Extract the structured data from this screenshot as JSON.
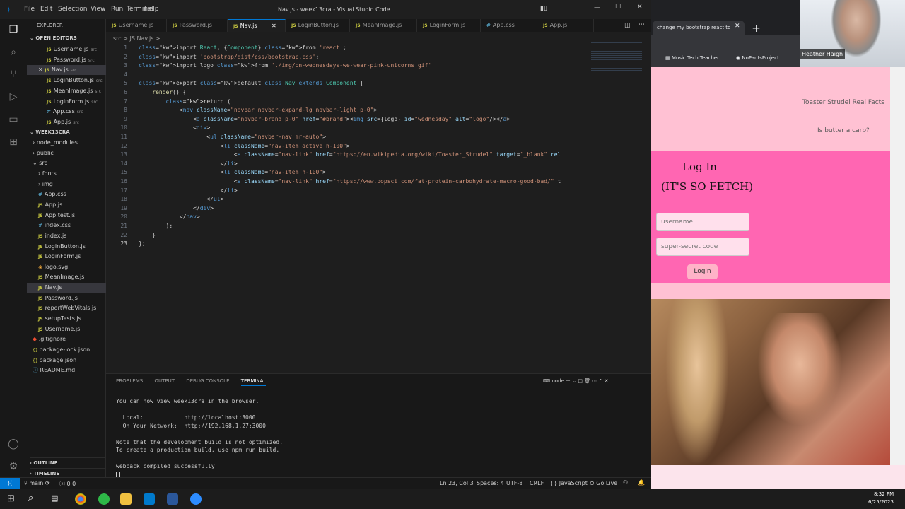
{
  "titlebar": {
    "menus": [
      "File",
      "Edit",
      "Selection",
      "View",
      "Run",
      "Terminal",
      "Help"
    ],
    "title": "Nav.js - week13cra - Visual Studio Code"
  },
  "sidebar": {
    "explorer_label": "EXPLORER",
    "open_editors_label": "OPEN EDITORS",
    "open_editors": [
      {
        "name": "Username.js",
        "hint": "src",
        "type": "js"
      },
      {
        "name": "Password.js",
        "hint": "src",
        "type": "js"
      },
      {
        "name": "Nav.js",
        "hint": "src",
        "type": "js"
      },
      {
        "name": "LoginButton.js",
        "hint": "src",
        "type": "js"
      },
      {
        "name": "MeanImage.js",
        "hint": "src",
        "type": "js"
      },
      {
        "name": "LoginForm.js",
        "hint": "src",
        "type": "js"
      },
      {
        "name": "App.css",
        "hint": "src",
        "type": "css"
      },
      {
        "name": "App.js",
        "hint": "src",
        "type": "js"
      }
    ],
    "project_label": "WEEK13CRA",
    "tree": [
      {
        "name": "node_modules",
        "type": "folder",
        "indent": 1
      },
      {
        "name": "public",
        "type": "folder",
        "indent": 1
      },
      {
        "name": "src",
        "type": "folder-open",
        "indent": 1
      },
      {
        "name": "fonts",
        "type": "folder",
        "indent": 2
      },
      {
        "name": "img",
        "type": "folder",
        "indent": 2
      },
      {
        "name": "App.css",
        "type": "css",
        "indent": 2
      },
      {
        "name": "App.js",
        "type": "js",
        "indent": 2
      },
      {
        "name": "App.test.js",
        "type": "js",
        "indent": 2
      },
      {
        "name": "index.css",
        "type": "css",
        "indent": 2
      },
      {
        "name": "index.js",
        "type": "js",
        "indent": 2
      },
      {
        "name": "LoginButton.js",
        "type": "js",
        "indent": 2
      },
      {
        "name": "LoginForm.js",
        "type": "js",
        "indent": 2
      },
      {
        "name": "logo.svg",
        "type": "svg",
        "indent": 2
      },
      {
        "name": "MeanImage.js",
        "type": "js",
        "indent": 2
      },
      {
        "name": "Nav.js",
        "type": "js",
        "indent": 2
      },
      {
        "name": "Password.js",
        "type": "js",
        "indent": 2
      },
      {
        "name": "reportWebVitals.js",
        "type": "js",
        "indent": 2
      },
      {
        "name": "setupTests.js",
        "type": "js",
        "indent": 2
      },
      {
        "name": "Username.js",
        "type": "js",
        "indent": 2
      },
      {
        "name": ".gitignore",
        "type": "git",
        "indent": 1
      },
      {
        "name": "package-lock.json",
        "type": "json",
        "indent": 1
      },
      {
        "name": "package.json",
        "type": "json",
        "indent": 1
      },
      {
        "name": "README.md",
        "type": "md",
        "indent": 1
      }
    ],
    "outline_label": "OUTLINE",
    "timeline_label": "TIMELINE"
  },
  "tabs": [
    {
      "label": "Username.js",
      "type": "js"
    },
    {
      "label": "Password.js",
      "type": "js"
    },
    {
      "label": "Nav.js",
      "type": "js"
    },
    {
      "label": "LoginButton.js",
      "type": "js"
    },
    {
      "label": "MeanImage.js",
      "type": "js"
    },
    {
      "label": "LoginForm.js",
      "type": "js"
    },
    {
      "label": "App.css",
      "type": "css"
    },
    {
      "label": "App.js",
      "type": "js"
    }
  ],
  "breadcrumb": "src > JS Nav.js > ...",
  "code_lines": [
    "import React, {Component} from 'react';",
    "import 'bootstrap/dist/css/bootstrap.css';",
    "import logo from './img/on-wednesdays-we-wear-pink-unicorns.gif'",
    "",
    "export default class Nav extends Component {",
    "    render() {",
    "        return (",
    "            <nav className=\"navbar navbar-expand-lg navbar-light p-0\">",
    "                <a className=\"navbar-brand p-0\" href=\"#brand\"><img src={logo} id=\"wednesday\" alt=\"logo\"/></a>",
    "                <div>",
    "                    <ul className=\"navbar-nav mr-auto\">",
    "                        <li className=\"nav-item active h-100\">",
    "                            <a className=\"nav-link\" href=\"https://en.wikipedia.org/wiki/Toaster_Strudel\" target=\"_blank\" rel",
    "                        </li>",
    "                        <li className=\"nav-item h-100\">",
    "                            <a className=\"nav-link\" href=\"https://www.popsci.com/fat-protein-carbohydrate-macro-good-bad/\" t",
    "                        </li>",
    "                    </ul>",
    "                </div>",
    "            </nav>",
    "        );",
    "    }",
    "};"
  ],
  "panel": {
    "tabs": [
      "PROBLEMS",
      "OUTPUT",
      "DEBUG CONSOLE",
      "TERMINAL"
    ],
    "shell": "node",
    "lines": [
      "You can now view week13cra in the browser.",
      "",
      "  Local:            http://localhost:3000",
      "  On Your Network:  http://192.168.1.27:3000",
      "",
      "Note that the development build is not optimized.",
      "To create a production build, use npm run build.",
      "",
      "webpack compiled successfully"
    ]
  },
  "status": {
    "branch": "main",
    "problems": "0 0",
    "position": "Ln 23, Col 3",
    "spaces": "Spaces: 4",
    "encoding": "UTF-8",
    "eol": "CRLF",
    "language": "JavaScript",
    "golive": "Go Live"
  },
  "browser": {
    "tab_title": "change my bootstrap react to",
    "bookmarks": [
      "Music Tech Teacher...",
      "NoPantsProject"
    ],
    "nav_links": [
      "Toaster Strudel Real Facts",
      "Is butter a carb?"
    ],
    "login_title": "Log In",
    "login_subtitle": "(IT'S SO FETCH)",
    "username_placeholder": "username",
    "password_placeholder": "super-secret code",
    "login_button": "Login"
  },
  "webcam": {
    "name": "Heather Haigh"
  },
  "taskbar": {
    "time": "8:32 PM",
    "date": "6/25/2023"
  }
}
